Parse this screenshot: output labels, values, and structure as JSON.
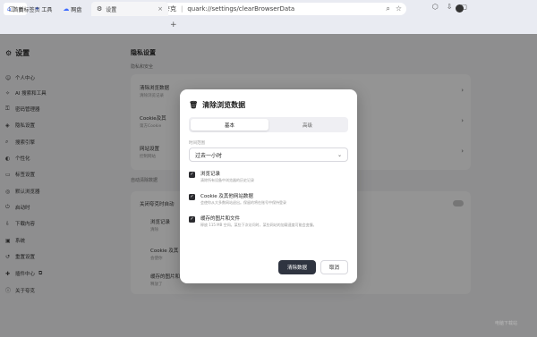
{
  "toolbar": {
    "quick": [
      {
        "label": "首页",
        "icon": "home-icon"
      },
      {
        "label": "工具",
        "icon": "tools-icon"
      },
      {
        "label": "网盘",
        "icon": "cloud-drive-icon"
      }
    ],
    "nav": {
      "back": "‹",
      "forward": "›",
      "reload": "↻"
    },
    "address": {
      "site_label": "夸克",
      "url": "quark://settings/clearBrowserData"
    }
  },
  "tabs": [
    {
      "label": "新标签页",
      "icon": "newtab-icon"
    },
    {
      "label": "设置",
      "icon": "gear-icon"
    }
  ],
  "sidebar": {
    "title": "设置",
    "items": [
      {
        "label": "个人中心",
        "icon": "user-icon"
      },
      {
        "label": "AI 搜索和工具",
        "icon": "ai-icon"
      },
      {
        "label": "密码管理器",
        "icon": "key-icon"
      },
      {
        "label": "隐私设置",
        "icon": "shield-icon"
      },
      {
        "label": "搜索引擎",
        "icon": "search-icon"
      },
      {
        "label": "个性化",
        "icon": "palette-icon"
      },
      {
        "label": "标签设置",
        "icon": "tab-icon"
      },
      {
        "label": "默认浏览器",
        "icon": "browser-icon"
      },
      {
        "label": "启动时",
        "icon": "power-icon"
      },
      {
        "label": "下载内容",
        "icon": "download-icon"
      },
      {
        "label": "系统",
        "icon": "system-icon"
      },
      {
        "label": "重置设置",
        "icon": "reset-icon"
      },
      {
        "label": "插件中心",
        "icon": "puzzle-icon"
      },
      {
        "label": "关于夸克",
        "icon": "info-icon"
      }
    ]
  },
  "main": {
    "title": "隐私设置",
    "section1": "隐私和安全",
    "rows": [
      {
        "title": "清除浏览数据",
        "sub": "清除浏览记录"
      },
      {
        "title": "Cookie及其",
        "sub": "第方Cookie"
      },
      {
        "title": "网站设置",
        "sub": "控制网站"
      }
    ],
    "section2": "自动清除数据",
    "auto_row": "关闭夸克时自动",
    "auto_items": [
      {
        "title": "浏览记录",
        "sub": "清除"
      },
      {
        "title": "Cookie 及其",
        "sub": "会使你"
      },
      {
        "title": "缓存的图片和",
        "sub": "释放了"
      }
    ]
  },
  "dialog": {
    "title": "清除浏览数据",
    "tabs": [
      "基本",
      "高级"
    ],
    "range_label": "时间范围",
    "range_value": "过去一小时",
    "options": [
      {
        "title": "浏览记录",
        "desc": "清除所有设备中浏览器的历史记录"
      },
      {
        "title": "Cookie 及其他网站数据",
        "desc": "会使你从大多数网站退出。保留的将在账号中保持登录"
      },
      {
        "title": "缓存的图片和文件",
        "desc": "释放 115 MB 空间。某些下次访问时，某些网站的加载速度可能会变慢。"
      }
    ],
    "confirm": "清除数据",
    "cancel": "取消"
  },
  "watermark": "电脑下载站"
}
